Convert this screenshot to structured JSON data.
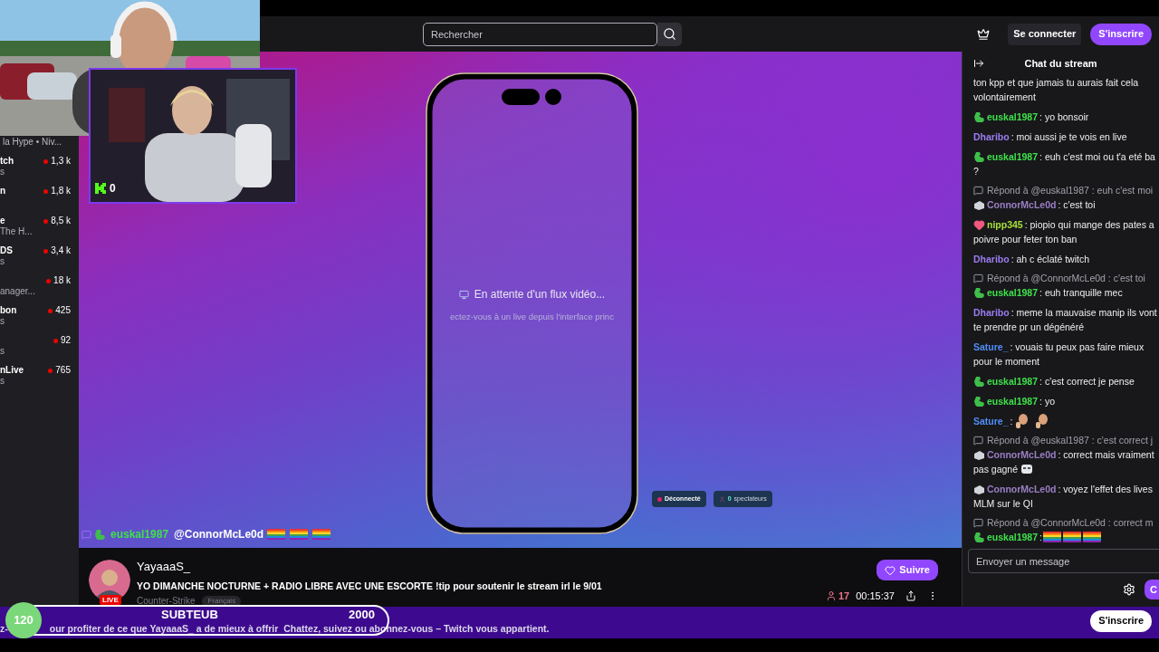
{
  "header": {
    "search": {
      "placeholder": "Rechercher"
    },
    "buttons": [
      {
        "label": "Se connecter",
        "kind": "secondary"
      },
      {
        "label": "S'inscrire",
        "kind": "primary"
      }
    ]
  },
  "guest_cam": {
    "counter": "0"
  },
  "sidebar": {
    "heading": "la Hype • Niv...",
    "channels": [
      {
        "name": "tch",
        "sub": "s",
        "viewers": "1,3 k"
      },
      {
        "name": "n",
        "viewers": "1,8 k"
      },
      {
        "name": "e",
        "sub": "The H...",
        "viewers": "8,5 k"
      },
      {
        "name": "DS",
        "sub": "s",
        "viewers": "3,4 k"
      },
      {
        "sub": "anager...",
        "viewers": "18 k"
      },
      {
        "name": "bon",
        "sub": "s",
        "viewers": "425"
      },
      {
        "sub": "s",
        "viewers": "92"
      },
      {
        "name": "nLive",
        "sub": "s",
        "viewers": "765"
      }
    ]
  },
  "player": {
    "waiting": "En attente d'un flux vidéo...",
    "hint": "ectez-vous à un live depuis l'interface princ",
    "status": {
      "label": "Déconnecté"
    },
    "viewers": {
      "count": "0",
      "label": "spectateurs"
    },
    "overlay_message": {
      "user": "euskal1987",
      "mention": "@ConnorMcLe0d",
      "emotes": [
        {
          "kind": "rainbow"
        },
        {
          "kind": "rainbow"
        },
        {
          "kind": "rainbow"
        }
      ]
    }
  },
  "stream": {
    "channel": "YayaaaS_",
    "live": "LIVE",
    "title": "YO DIMANCHE NOCTURNE + RADIO LIBRE AVEC UNE ESCORTE !tip pour soutenir le stream irl le 9/01",
    "category": "Counter-Strike",
    "tags": [
      "Français"
    ],
    "follow": "Suivre",
    "viewers": "17",
    "uptime": "00:15:37"
  },
  "chat": {
    "title": "Chat du stream",
    "messages": [
      {
        "kind": "continuation",
        "lines": [
          "ton kpp et que jamais tu aurais fait cela",
          "volontairement"
        ]
      },
      {
        "kind": "message",
        "user": "euskal1987",
        "color": "#3fe04a",
        "badge": {
          "kind": "dino"
        },
        "lines": [
          ": yo bonsoir"
        ]
      },
      {
        "kind": "message",
        "user": "Dharibo",
        "color": "#9b7cf0",
        "lines": [
          ": moi aussi je te vois en live"
        ]
      },
      {
        "kind": "message",
        "user": "euskal1987",
        "color": "#3fe04a",
        "badge": {
          "kind": "dino"
        },
        "lines": [
          ": euh c'est moi ou t'a eté ba",
          "?"
        ]
      },
      {
        "kind": "reply",
        "text": "Répond à @euskal1987 : euh c'est moi"
      },
      {
        "kind": "message",
        "user": "ConnorMcLe0d",
        "color": "#9a7fc4",
        "badge": {
          "kind": "grey"
        },
        "lines": [
          ": c'est toi"
        ]
      },
      {
        "kind": "message",
        "user": "nipp345",
        "color": "#a8e03a",
        "badge": {
          "kind": "heart"
        },
        "lines": [
          ": piopio qui mange des pates a",
          "poivre pour feter ton ban"
        ]
      },
      {
        "kind": "message",
        "user": "Dharibo",
        "color": "#9b7cf0",
        "lines": [
          ": ah c éclaté twitch"
        ]
      },
      {
        "kind": "reply",
        "text": "Répond à @ConnorMcLe0d : c'est toi"
      },
      {
        "kind": "message",
        "user": "euskal1987",
        "color": "#3fe04a",
        "badge": {
          "kind": "dino"
        },
        "lines": [
          ": euh tranquille mec"
        ]
      },
      {
        "kind": "message",
        "user": "Dharibo",
        "color": "#9b7cf0",
        "lines": [
          ": meme la mauvaise manip ils vont",
          "te prendre pr un dégénéré"
        ]
      },
      {
        "kind": "message",
        "user": "Sature_",
        "color": "#4f8ef7",
        "lines": [
          ": vouais tu peux pas faire mieux",
          "pour le moment"
        ]
      },
      {
        "kind": "message",
        "user": "euskal1987",
        "color": "#3fe04a",
        "badge": {
          "kind": "dino"
        },
        "lines": [
          ": c'est correct je pense"
        ]
      },
      {
        "kind": "message",
        "user": "euskal1987",
        "color": "#3fe04a",
        "badge": {
          "kind": "dino"
        },
        "lines": [
          ": yo"
        ]
      },
      {
        "kind": "message",
        "user": "Sature_",
        "color": "#4f8ef7",
        "lines": [
          ":"
        ],
        "emotes": [
          {
            "kind": "face"
          },
          {
            "kind": "face"
          }
        ]
      },
      {
        "kind": "reply",
        "text": "Répond à @euskal1987 : c'est correct j"
      },
      {
        "kind": "message",
        "user": "ConnorMcLe0d",
        "color": "#9a7fc4",
        "badge": {
          "kind": "grey"
        },
        "lines": [
          ": correct mais vraiment",
          "pas gagné"
        ],
        "emotes": [
          {
            "kind": "mask"
          }
        ]
      },
      {
        "kind": "message",
        "user": "ConnorMcLe0d",
        "color": "#9a7fc4",
        "badge": {
          "kind": "grey"
        },
        "lines": [
          ": voyez l'effet des lives",
          "MLM sur le QI"
        ]
      },
      {
        "kind": "reply",
        "text": "Répond à @ConnorMcLe0d : correct m"
      },
      {
        "kind": "message",
        "user": "euskal1987",
        "color": "#3fe04a",
        "badge": {
          "kind": "dino"
        },
        "lines": [
          ":"
        ],
        "emotes": [
          {
            "kind": "rainbow"
          },
          {
            "kind": "rainbow"
          },
          {
            "kind": "rainbow"
          }
        ]
      }
    ],
    "input": {
      "placeholder": "Envoyer un message"
    },
    "chat_button": "C"
  },
  "banner": {
    "texts": [
      "z-",
      "our profiter de ce que YayaaaS_ a de mieux à offrir",
      "Chattez, suivez ou abonnez-vous – Twitch vous appartient."
    ],
    "button": "S'inscrire"
  },
  "sub_goal": {
    "current": "120",
    "title": "SUBTEUB",
    "target": "2000"
  }
}
